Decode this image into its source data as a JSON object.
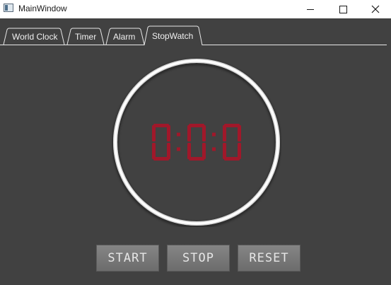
{
  "window": {
    "title": "MainWindow",
    "icon": "app-window-icon",
    "controls": [
      "minimize-icon",
      "maximize-icon",
      "close-icon"
    ]
  },
  "tabs": [
    {
      "label": "World Clock",
      "active": false
    },
    {
      "label": "Timer",
      "active": false
    },
    {
      "label": "Alarm",
      "active": false
    },
    {
      "label": "StopWatch",
      "active": true
    }
  ],
  "stopwatch": {
    "display": "0:0:0",
    "digit_color": "#a0182a",
    "ring_color": "#ffffff"
  },
  "buttons": {
    "start_label": "START",
    "stop_label": "STOP",
    "reset_label": "RESET"
  },
  "colors": {
    "background": "#414141",
    "tab_text": "#f0f0f0"
  }
}
